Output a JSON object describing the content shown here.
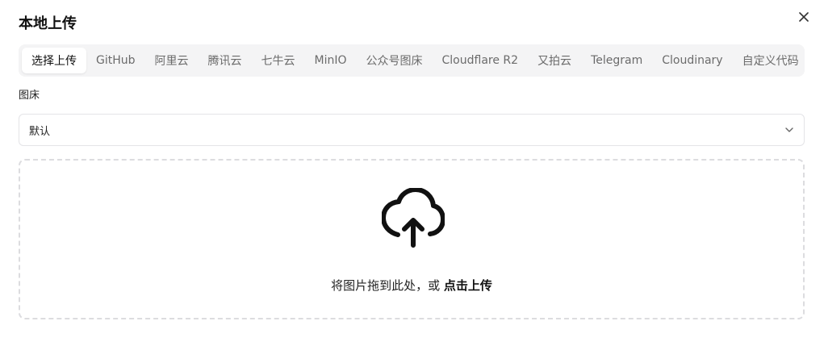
{
  "dialog": {
    "title": "本地上传",
    "close_icon": "close-icon"
  },
  "tabs": [
    {
      "label": "选择上传",
      "active": true
    },
    {
      "label": "GitHub",
      "active": false
    },
    {
      "label": "阿里云",
      "active": false
    },
    {
      "label": "腾讯云",
      "active": false
    },
    {
      "label": "七牛云",
      "active": false
    },
    {
      "label": "MinIO",
      "active": false
    },
    {
      "label": "公众号图床",
      "active": false
    },
    {
      "label": "Cloudflare R2",
      "active": false
    },
    {
      "label": "又拍云",
      "active": false
    },
    {
      "label": "Telegram",
      "active": false
    },
    {
      "label": "Cloudinary",
      "active": false
    },
    {
      "label": "自定义代码",
      "active": false
    }
  ],
  "image_host": {
    "label": "图床",
    "selected": "默认",
    "chevron_icon": "chevron-down-icon"
  },
  "dropzone": {
    "icon": "upload-cloud-icon",
    "text": "将图片拖到此处，或",
    "link": "点击上传"
  },
  "colors": {
    "tabs_background": "#f4f4f5",
    "active_tab_background": "#ffffff",
    "border": "#e4e4e7",
    "dashed_border": "#dcdcdf"
  }
}
